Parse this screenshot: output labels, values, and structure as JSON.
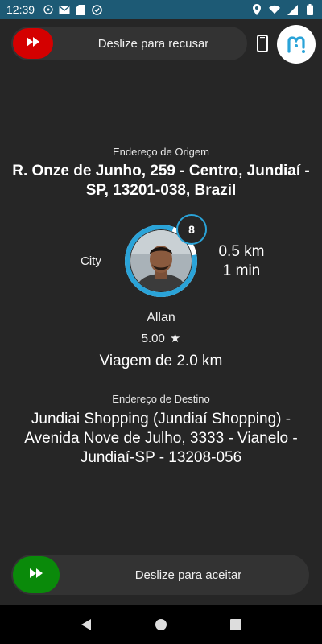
{
  "status_bar": {
    "time": "12:39",
    "icons_left": [
      "notification-icon",
      "mail-icon",
      "sd-card-icon",
      "app-icon"
    ],
    "icons_right": [
      "location-icon",
      "wifi-icon",
      "signal-icon",
      "battery-icon"
    ]
  },
  "decline": {
    "label": "Deslize para recusar",
    "color": "#d40000"
  },
  "brand": {
    "logo_text": "m",
    "color": "#2aa3d8"
  },
  "origin": {
    "caption": "Endereço de Origem",
    "address": "R. Onze de Junho, 259 - Centro, Jundiaí - SP, 13201-038, Brazil"
  },
  "ride": {
    "category": "City",
    "rank": "8",
    "distance": "0.5 km",
    "eta": "1 min",
    "accent_color": "#2aa3d8"
  },
  "passenger": {
    "name": "Allan",
    "rating": "5.00",
    "rating_icon": "★"
  },
  "trip": {
    "distance_text": "Viagem de 2.0 km"
  },
  "destination": {
    "caption": "Endereço de Destino",
    "address": "Jundiai Shopping (Jundiaí Shopping) - Avenida Nove de Julho, 3333 - Vianelo - Jundiaí-SP - 13208-056"
  },
  "accept": {
    "label": "Deslize para aceitar",
    "color": "#0a8a0a"
  },
  "nav": {
    "buttons": [
      "back-icon",
      "home-icon",
      "recents-icon"
    ]
  }
}
